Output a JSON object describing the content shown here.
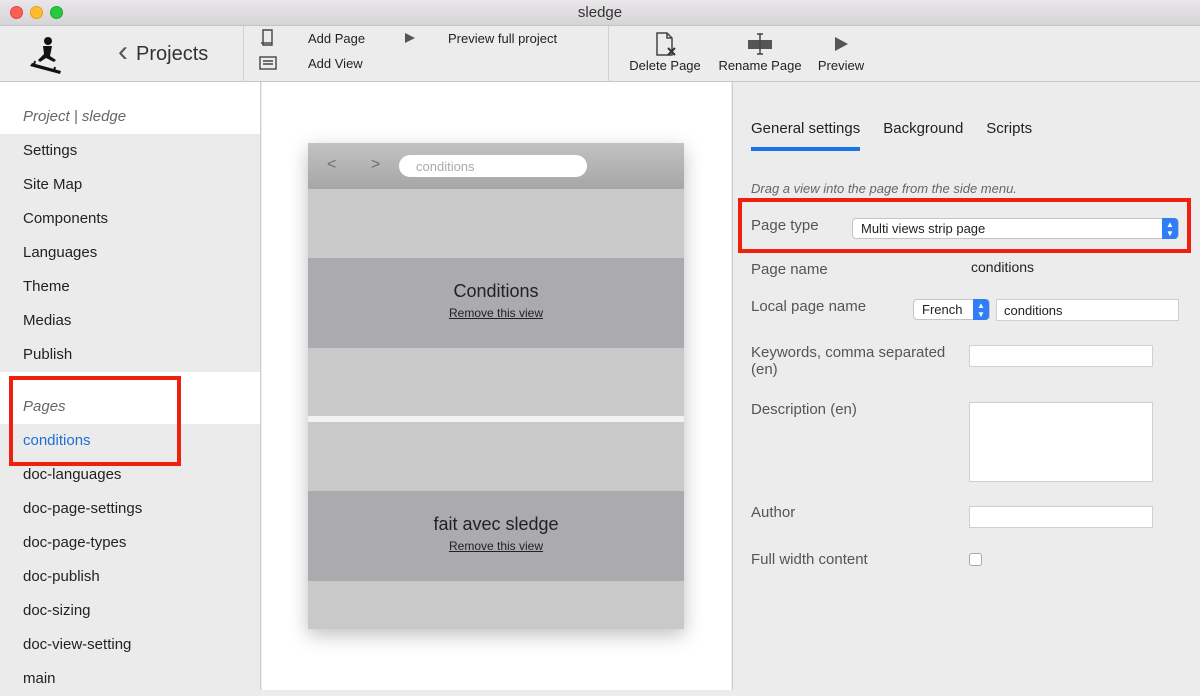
{
  "window": {
    "title": "sledge"
  },
  "toolbar": {
    "back_label": "Projects",
    "add_page": "Add Page",
    "add_view": "Add View",
    "preview_full": "Preview full project",
    "delete_page": "Delete Page",
    "rename_page": "Rename Page",
    "preview": "Preview"
  },
  "sidebar": {
    "project_header": "Project | sledge",
    "project_items": [
      "Settings",
      "Site Map",
      "Components",
      "Languages",
      "Theme",
      "Medias",
      "Publish"
    ],
    "pages_header": "Pages",
    "pages": [
      "conditions",
      "doc-languages",
      "doc-page-settings",
      "doc-page-types",
      "doc-publish",
      "doc-sizing",
      "doc-view-setting",
      "main"
    ],
    "selected_page": "conditions"
  },
  "canvas": {
    "back_glyph": "<",
    "forward_glyph": ">",
    "url": "conditions",
    "views": [
      {
        "title": "Conditions",
        "remove_label": "Remove this view"
      },
      {
        "title": "fait avec sledge",
        "remove_label": "Remove this view"
      }
    ]
  },
  "panel": {
    "tabs": [
      "General settings",
      "Background",
      "Scripts"
    ],
    "active_tab": "General settings",
    "hint": "Drag a view into the page from the side menu.",
    "page_type_label": "Page type",
    "page_type_value": "Multi views strip page",
    "page_name_label": "Page name",
    "page_name_value": "conditions",
    "local_name_label": "Local page name",
    "language_value": "French",
    "local_name_value": "conditions",
    "keywords_label_1": "Keywords, comma separated",
    "keywords_label_2": "(en)",
    "keywords_value": "",
    "description_label": "Description (en)",
    "author_label": "Author",
    "author_value": "",
    "full_width_label": "Full width content",
    "full_width_checked": false
  },
  "colors": {
    "accent": "#1a73e8",
    "highlight": "#f0200e",
    "selected_text": "#1f6fd6"
  },
  "icons": [
    "sledge-logo-icon",
    "chevron-left-icon",
    "page-icon",
    "view-icon",
    "play-icon",
    "delete-page-icon",
    "rename-page-icon"
  ]
}
